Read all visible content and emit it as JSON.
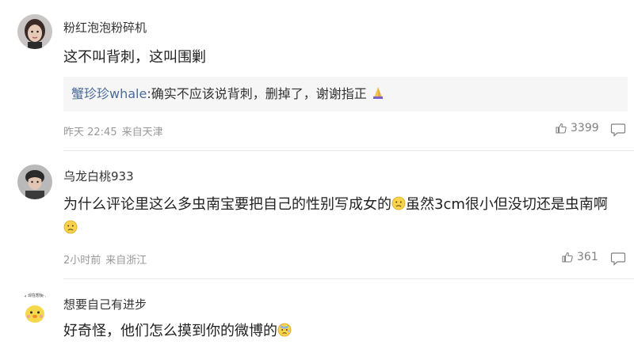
{
  "comments": [
    {
      "username": "粉红泡泡粉碎机",
      "avatar_icon": "user-avatar-girl",
      "content": "这不叫背刺，这叫围剿",
      "reply": {
        "user": "蟹珍珍whale",
        "separator": ":",
        "text": "确实不应该说背刺，删掉了，谢谢指正",
        "emoji": "praying-hands-emoji"
      },
      "time": "昨天 22:45",
      "location": "来自天津",
      "likes": "3399"
    },
    {
      "username": "乌龙白桃933",
      "avatar_icon": "user-avatar-boy",
      "content_part1": "为什么评论里这么多虫南宝要把自己的性别写成女的",
      "content_part2": "虽然3cm很小但没切还是虫南啊",
      "emoji": "sad-face-emoji",
      "time": "2小时前",
      "location": "来自浙江",
      "likes": "361"
    },
    {
      "username": "想要自己有进步",
      "avatar_icon": "user-avatar-duck",
      "avatar_caption": "JQ 现在想要不",
      "content": "好奇怪，他们怎么摸到你的微博的",
      "emoji": "cold-sweat-emoji"
    }
  ]
}
